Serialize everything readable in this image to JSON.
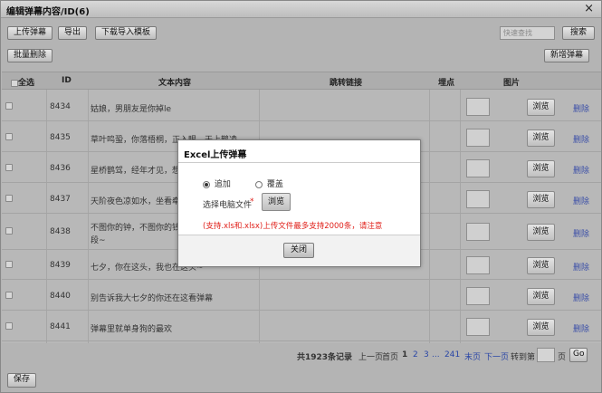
{
  "window": {
    "title": "编辑弹幕内容/ID(6)",
    "close_glyph": "×"
  },
  "toolbar": {
    "upload_label": "上传弹幕",
    "export_label": "导出",
    "download_template_label": "下载导入模板",
    "search_placeholder": "快速查找",
    "search_label": "搜索",
    "batch_delete_label": "批量删除",
    "add_label": "新增弹幕"
  },
  "table": {
    "headers": {
      "select_all": "全选",
      "id": "ID",
      "content": "文本内容",
      "link": "跳转链接",
      "hotspot": "埋点",
      "image": "图片"
    },
    "browse_label": "浏览",
    "delete_label": "删除",
    "rows": [
      {
        "id": "8434",
        "text": "姑娘，男朋友是你掉le"
      },
      {
        "id": "8435",
        "text": "草叶鸣蛩，你落梧桐，正入眼，天上鹊凌"
      },
      {
        "id": "8436",
        "text": "星桥鹊驾，经年才见，想离"
      },
      {
        "id": "8437",
        "text": "天阶夜色凉如水，坐看牵牛"
      },
      {
        "id": "8438",
        "text": "不图你的钟，不图你的钱，",
        "text2": "段~"
      },
      {
        "id": "8439",
        "text": "七夕，你在这头，我也在这头~"
      },
      {
        "id": "8440",
        "text": "别告诉我大七夕的你还在这看弹幕"
      },
      {
        "id": "8441",
        "text": "弹幕里就单身狗的最欢"
      }
    ]
  },
  "pager": {
    "total": "共1923条记录",
    "prev": "上一页",
    "first": "首页",
    "p1": "1",
    "p2": "2",
    "p3": "3",
    "ellipsis": "...",
    "p241": "241",
    "last": "末页",
    "next": "下一页",
    "goto_label": "转到第",
    "page_unit": "页",
    "go_label": "Go"
  },
  "footer": {
    "save_label": "保存"
  },
  "dialog": {
    "title": "Excel上传弹幕",
    "option_append": "追加",
    "option_overwrite": "覆盖",
    "file_label": "选择电脑文件",
    "required_mark": "*",
    "browse_label": "浏览",
    "hint": "(支持.xls和.xlsx)上传文件最多支持2000条，请注意",
    "close_label": "关闭",
    "selected_option": "追加"
  },
  "colors": {
    "hint_red": "#e0201a",
    "link_blue": "#2a46a6"
  }
}
